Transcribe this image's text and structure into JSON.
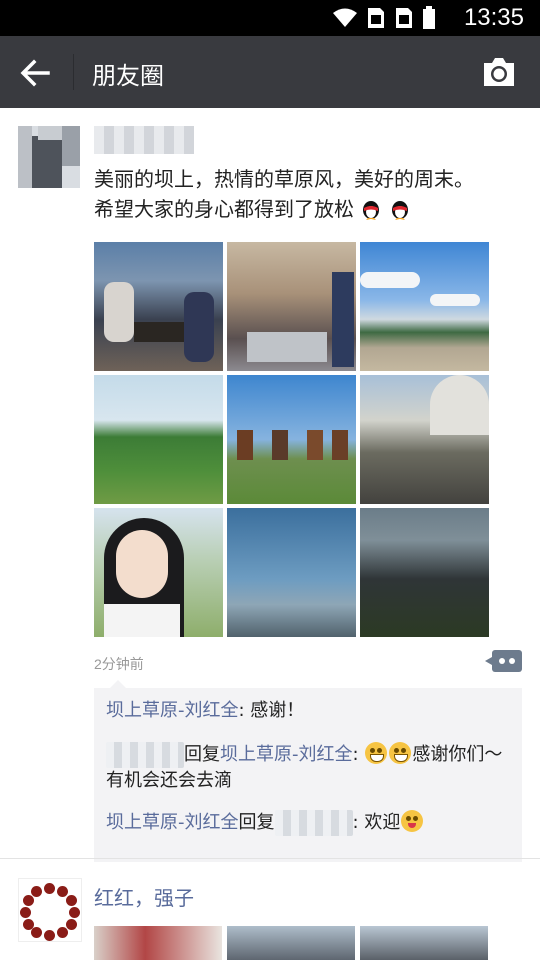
{
  "status": {
    "time": "13:35"
  },
  "header": {
    "title": "朋友圈"
  },
  "post": {
    "text_line1": "美丽的坝上，热情的草原风，美好的周末。",
    "text_line2": "希望大家的身心都得到了放松",
    "time_ago": "2分钟前",
    "comments": [
      {
        "name": "坝上草原-刘红全",
        "text": ": 感谢！"
      },
      {
        "reply_word": "回复",
        "to": "坝上草原-刘红全",
        "text": ": ",
        "text2": "感谢你们～有机会还会去滴"
      },
      {
        "name": "坝上草原-刘红全",
        "reply_word": "回复",
        "text": ": 欢迎"
      }
    ]
  },
  "next_post": {
    "name": "红红，强子"
  },
  "colors": {
    "appbar": "#393a3f",
    "link": "#596b9b",
    "status_bar": "#000000"
  }
}
